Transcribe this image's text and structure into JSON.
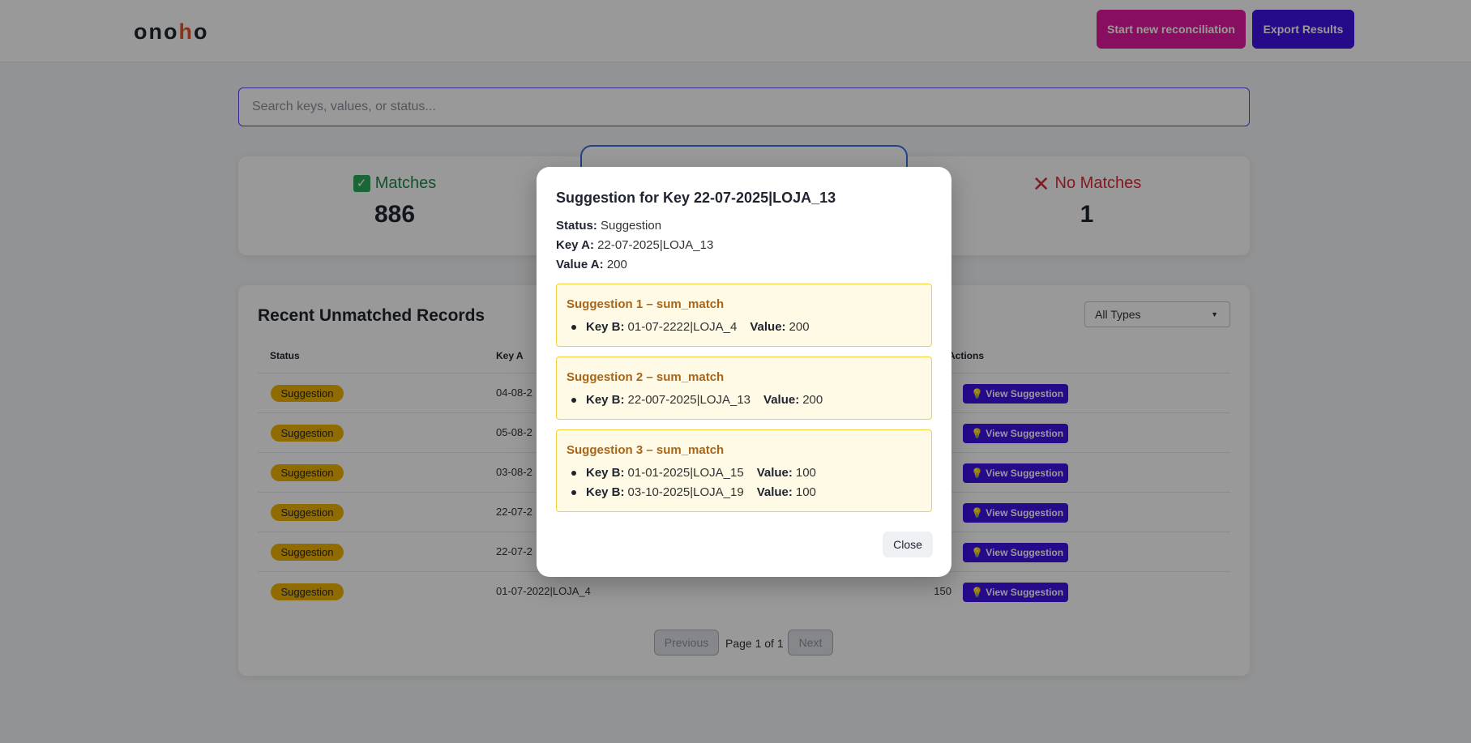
{
  "header": {
    "logo_prefix": "ono",
    "logo_accent": "h",
    "logo_suffix": "o",
    "start_button": "Start new reconciliation",
    "export_button": "Export Results"
  },
  "search": {
    "placeholder": "Search keys, values, or status..."
  },
  "stats": {
    "matches_label": "Matches",
    "matches_value": "886",
    "no_matches_label": "No Matches",
    "no_matches_value": "1"
  },
  "table": {
    "title": "Recent Unmatched Records",
    "filter_selected": "All Types",
    "columns": {
      "status": "Status",
      "key_a": "Key A",
      "actions": "Actions"
    },
    "rows": [
      {
        "status": "Suggestion",
        "key": "04-08-2",
        "value": "",
        "action": "View Suggestion"
      },
      {
        "status": "Suggestion",
        "key": "05-08-2",
        "value": "",
        "action": "View Suggestion"
      },
      {
        "status": "Suggestion",
        "key": "03-08-2",
        "value": "",
        "action": "View Suggestion"
      },
      {
        "status": "Suggestion",
        "key": "22-07-2",
        "value": "",
        "action": "View Suggestion"
      },
      {
        "status": "Suggestion",
        "key": "22-07-2",
        "value": "",
        "action": "View Suggestion"
      },
      {
        "status": "Suggestion",
        "key": "01-07-2022|LOJA_4",
        "value": "150",
        "action": "View Suggestion"
      }
    ],
    "pagination": {
      "previous": "Previous",
      "page_text": "Page 1 of 1",
      "next": "Next"
    }
  },
  "modal": {
    "title": "Suggestion for Key 22-07-2025|LOJA_13",
    "status_label": "Status:",
    "status_value": "Suggestion",
    "key_a_label": "Key A:",
    "key_a_value": "22-07-2025|LOJA_13",
    "value_a_label": "Value A:",
    "value_a_value": "200",
    "key_b_label": "Key B:",
    "value_label": "Value:",
    "suggestions": [
      {
        "title": "Suggestion 1 – sum_match",
        "items": [
          {
            "key": "01-07-2222|LOJA_4",
            "value": "200"
          }
        ]
      },
      {
        "title": "Suggestion 2 – sum_match",
        "items": [
          {
            "key": "22-007-2025|LOJA_13",
            "value": "200"
          }
        ]
      },
      {
        "title": "Suggestion 3 – sum_match",
        "items": [
          {
            "key": "01-01-2025|LOJA_15",
            "value": "100"
          },
          {
            "key": "03-10-2025|LOJA_19",
            "value": "100"
          }
        ]
      }
    ],
    "close_button": "Close"
  },
  "icons": {
    "matches": "check-box-icon",
    "no_matches": "x-icon",
    "view": "lightbulb-icon",
    "select": "caret-down-icon"
  },
  "colors": {
    "primary": "#3f12e6",
    "start": "#e3199e",
    "badge": "#f0b400",
    "match_green": "#1e8a4a",
    "nomatch_red": "#dd2a3a"
  }
}
